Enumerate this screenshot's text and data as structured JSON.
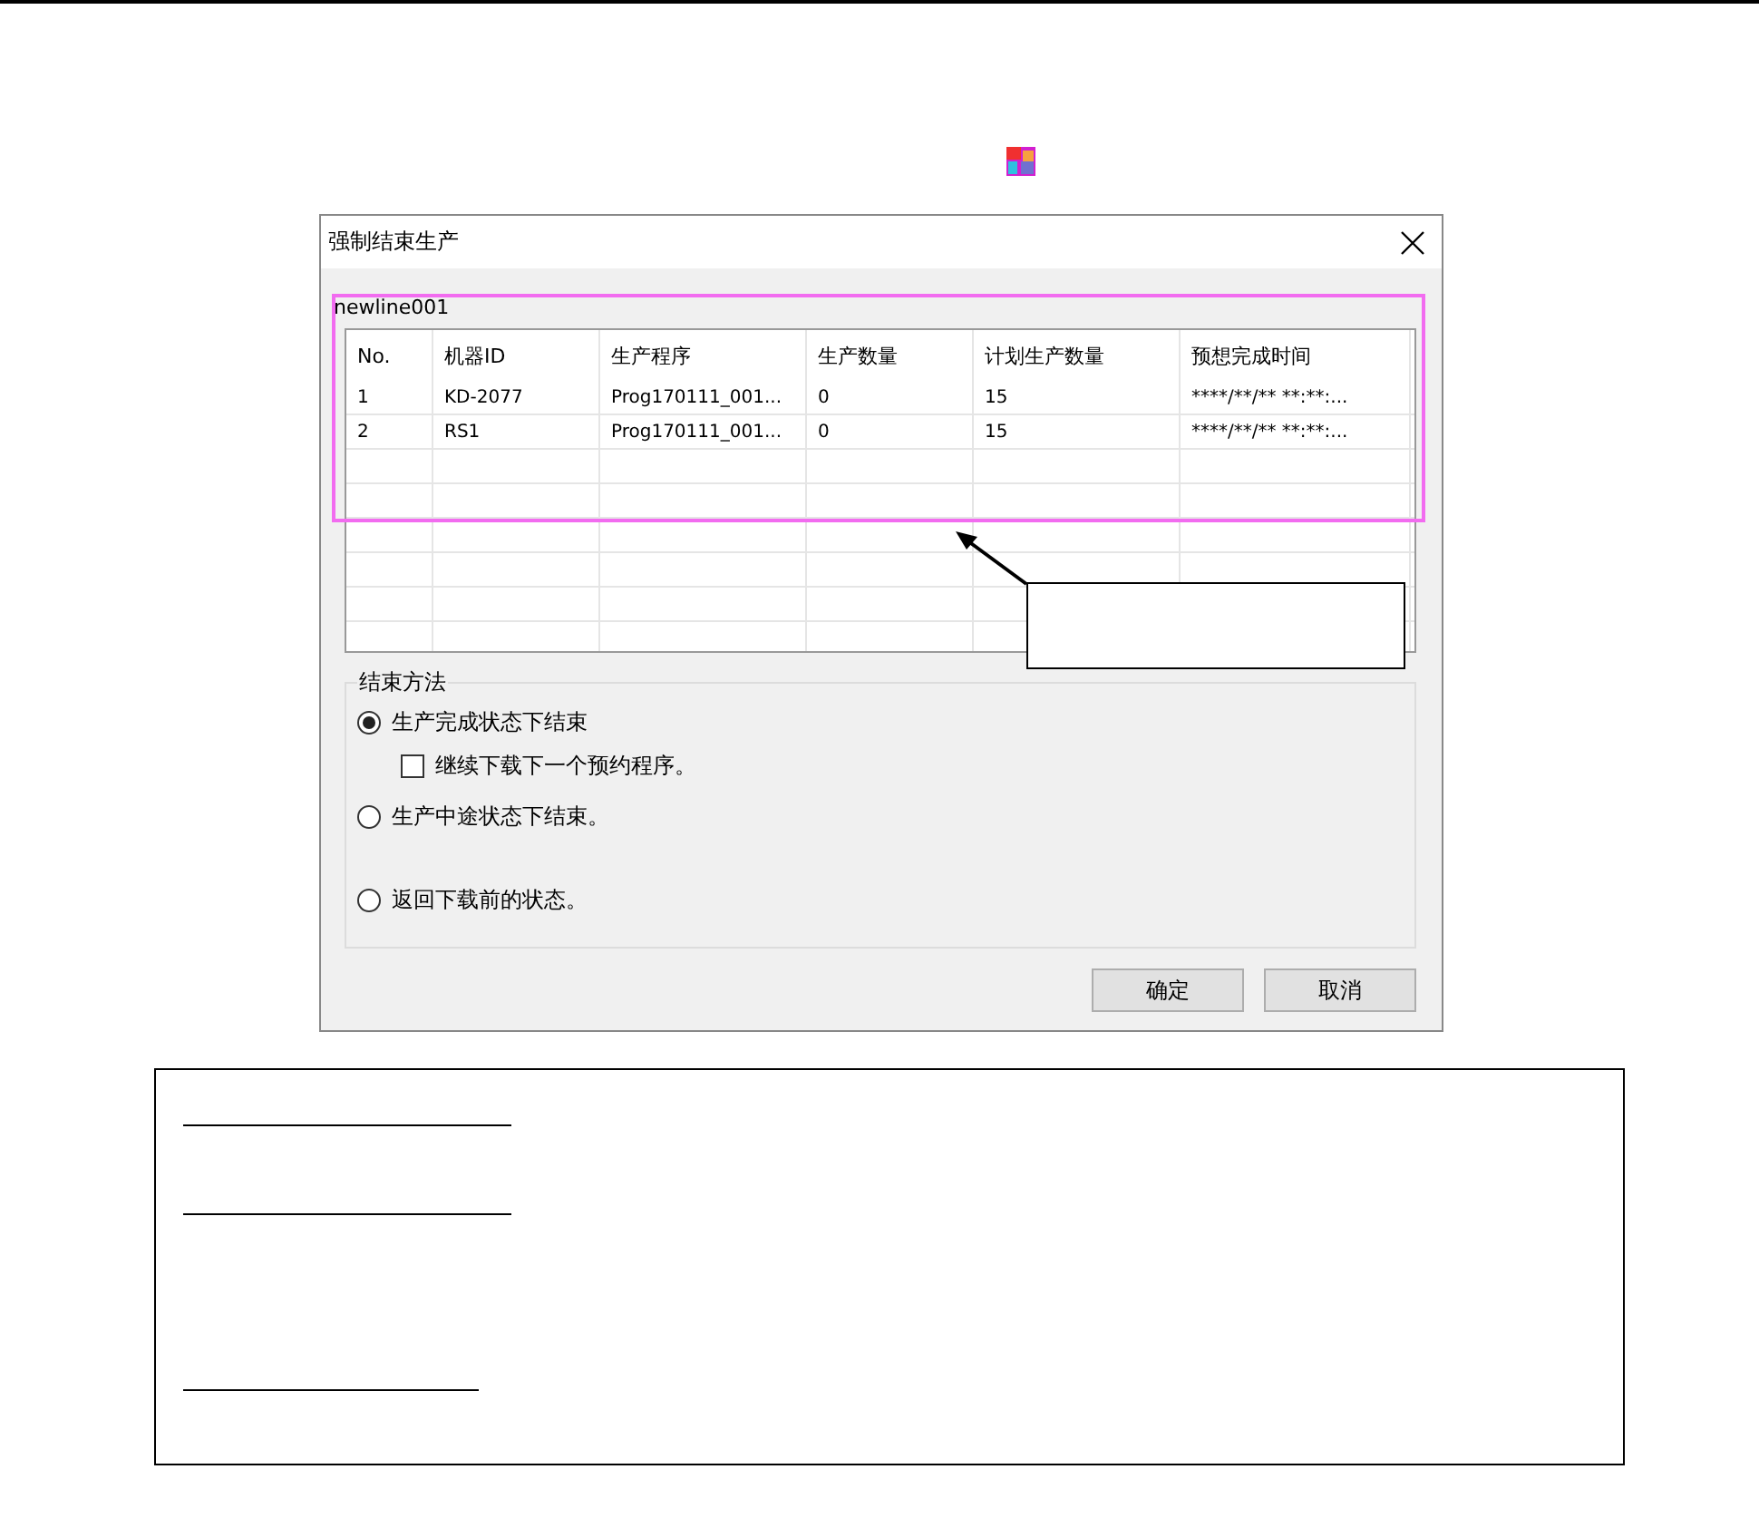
{
  "dialog": {
    "title": "强制结束生产",
    "group": "newline001",
    "columns": [
      "No.",
      "机器ID",
      "生产程序",
      "生产数量",
      "计划生产数量",
      "预想完成时间"
    ],
    "rows": [
      [
        "1",
        "KD-2077",
        "Prog170111_001...",
        "0",
        "15",
        "****/**/** **:**:..."
      ],
      [
        "2",
        "RS1",
        "Prog170111_001...",
        "0",
        "15",
        "****/**/** **:**:..."
      ]
    ],
    "end_method": {
      "label": "结束方法",
      "options": [
        {
          "label": "生产完成状态下结束",
          "selected": true,
          "sub_option": {
            "label": "继续下载下一个预约程序。",
            "checked": false
          }
        },
        {
          "label": "生产中途状态下结束。",
          "selected": false
        },
        {
          "label": "返回下载前的状态。",
          "selected": false
        }
      ]
    },
    "buttons": [
      "确定",
      "取消"
    ]
  }
}
